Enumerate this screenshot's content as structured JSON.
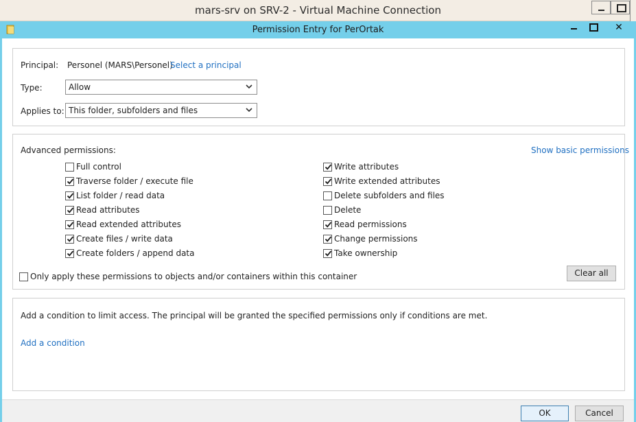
{
  "vm_window": {
    "title": "mars-srv on SRV-2 - Virtual Machine Connection"
  },
  "dialog": {
    "title": "Permission Entry for PerOrtak"
  },
  "principal": {
    "label": "Principal:",
    "value": "Personel (MARS\\Personel)",
    "select_link": "Select a principal"
  },
  "type_field": {
    "label": "Type:",
    "value": "Allow"
  },
  "applies_field": {
    "label": "Applies to:",
    "value": "This folder, subfolders and files"
  },
  "advanced": {
    "label": "Advanced permissions:",
    "show_basic_link": "Show basic permissions",
    "left": [
      {
        "label": "Full control",
        "checked": false
      },
      {
        "label": "Traverse folder / execute file",
        "checked": true
      },
      {
        "label": "List folder / read data",
        "checked": true
      },
      {
        "label": "Read attributes",
        "checked": true
      },
      {
        "label": "Read extended attributes",
        "checked": true
      },
      {
        "label": "Create files / write data",
        "checked": true
      },
      {
        "label": "Create folders / append data",
        "checked": true
      }
    ],
    "right": [
      {
        "label": "Write attributes",
        "checked": true
      },
      {
        "label": "Write extended attributes",
        "checked": true
      },
      {
        "label": "Delete subfolders and files",
        "checked": false
      },
      {
        "label": "Delete",
        "checked": false
      },
      {
        "label": "Read permissions",
        "checked": true
      },
      {
        "label": "Change permissions",
        "checked": true
      },
      {
        "label": "Take ownership",
        "checked": true
      }
    ],
    "only_apply": {
      "label": "Only apply these permissions to objects and/or containers within this container",
      "checked": false
    },
    "clear_all": "Clear all"
  },
  "condition": {
    "description": "Add a condition to limit access. The principal will be granted the specified permissions only if conditions are met.",
    "add_link": "Add a condition"
  },
  "footer": {
    "ok": "OK",
    "cancel": "Cancel"
  },
  "colors": {
    "dialog_titlebar": "#74cfea",
    "link": "#1f6fc1",
    "vm_titlebar": "#f3ede4"
  }
}
